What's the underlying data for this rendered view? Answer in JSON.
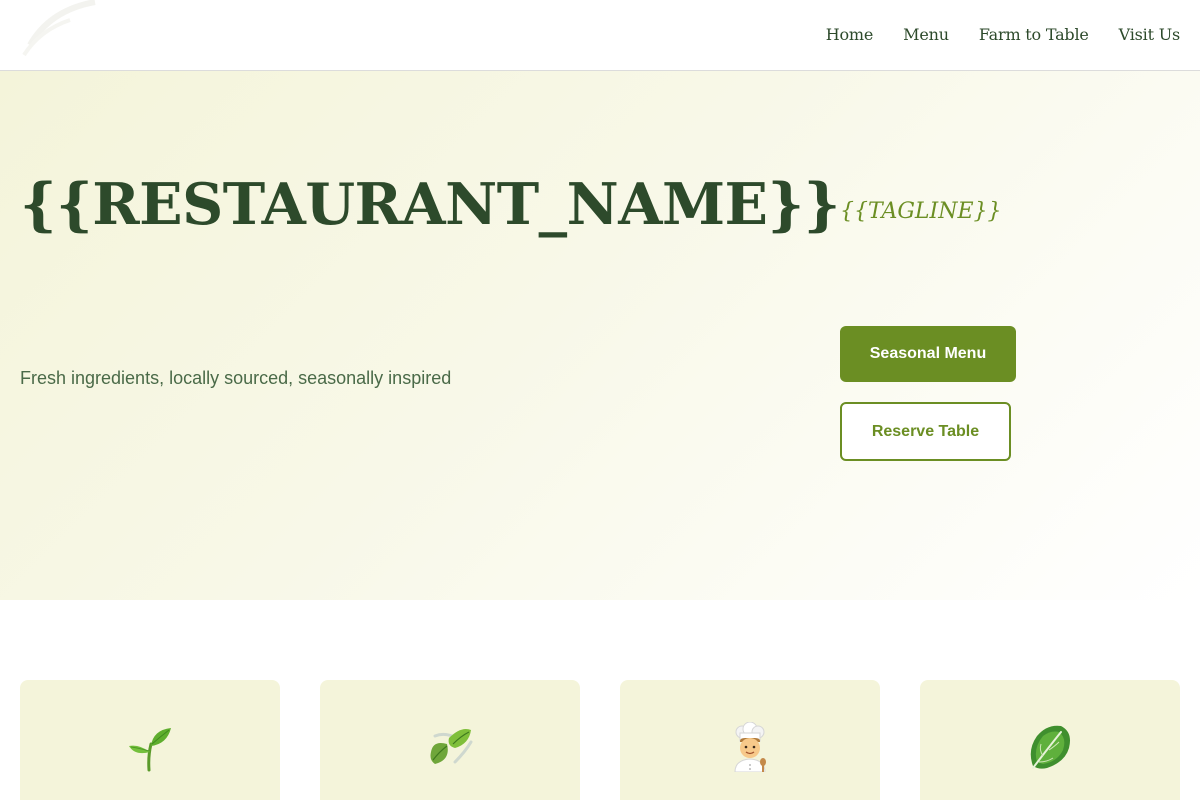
{
  "nav": {
    "items": [
      {
        "label": "Home"
      },
      {
        "label": "Menu"
      },
      {
        "label": "Farm to Table"
      },
      {
        "label": "Visit Us"
      }
    ]
  },
  "hero": {
    "title": "{{RESTAURANT_NAME}}",
    "tagline": "{{TAGLINE}}",
    "subtitle": "Fresh ingredients, locally sourced, seasonally inspired",
    "primary_button": "Seasonal Menu",
    "secondary_button": "Reserve Table"
  },
  "features": [
    {
      "icon": "seedling-icon"
    },
    {
      "icon": "leaves-icon"
    },
    {
      "icon": "chef-icon"
    },
    {
      "icon": "leafy-green-icon"
    }
  ],
  "colors": {
    "brand_dark_green": "#2d4a2b",
    "accent_olive": "#6b8e23",
    "hero_tint": "#f4f4da",
    "text_muted": "#4a6a48"
  }
}
